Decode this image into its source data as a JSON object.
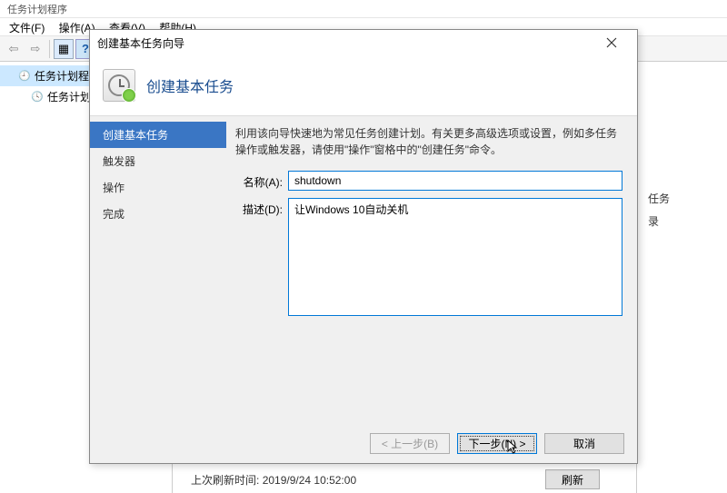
{
  "app": {
    "title": "任务计划程序",
    "menu": {
      "file": "文件(F)",
      "action": "操作(A)",
      "view": "查看(V)",
      "help": "帮助(H)"
    },
    "tree": {
      "root": "任务计划程序 (本地",
      "library": "任务计划程序库"
    },
    "status": {
      "last_refresh_label": "上次刷新时间:",
      "last_refresh_value": "2019/9/24 10:52:00",
      "refresh_button": "刷新"
    },
    "right_actions": {
      "item1": "任务",
      "item2": "录"
    }
  },
  "dialog": {
    "title": "创建基本任务向导",
    "header_title": "创建基本任务",
    "steps": {
      "s1": "创建基本任务",
      "s2": "触发器",
      "s3": "操作",
      "s4": "完成"
    },
    "intro": "利用该向导快速地为常见任务创建计划。有关更多高级选项或设置，例如多任务操作或触发器，请使用\"操作\"窗格中的\"创建任务\"命令。",
    "form": {
      "name_label": "名称(A):",
      "name_value": "shutdown",
      "desc_label": "描述(D):",
      "desc_value": "让Windows 10自动关机"
    },
    "buttons": {
      "back": "< 上一步(B)",
      "next": "下一步(N) >",
      "cancel": "取消"
    }
  }
}
